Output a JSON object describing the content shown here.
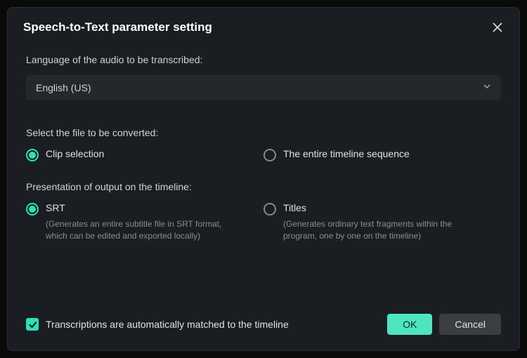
{
  "dialog": {
    "title": "Speech-to-Text parameter setting"
  },
  "language": {
    "label": "Language of the audio to be transcribed:",
    "selected": "English (US)"
  },
  "fileSelect": {
    "label": "Select the file to be converted:",
    "options": {
      "clip": "Clip selection",
      "timeline": "The entire timeline sequence"
    }
  },
  "presentation": {
    "label": "Presentation of output on the timeline:",
    "srt": {
      "label": "SRT",
      "desc": "(Generates an entire subtitle file in SRT format, which can be edited and exported locally)"
    },
    "titles": {
      "label": "Titles",
      "desc": "(Generates ordinary text fragments within the program, one by one on the timeline)"
    }
  },
  "checkbox": {
    "label": "Transcriptions are automatically matched to the timeline"
  },
  "buttons": {
    "ok": "OK",
    "cancel": "Cancel"
  }
}
